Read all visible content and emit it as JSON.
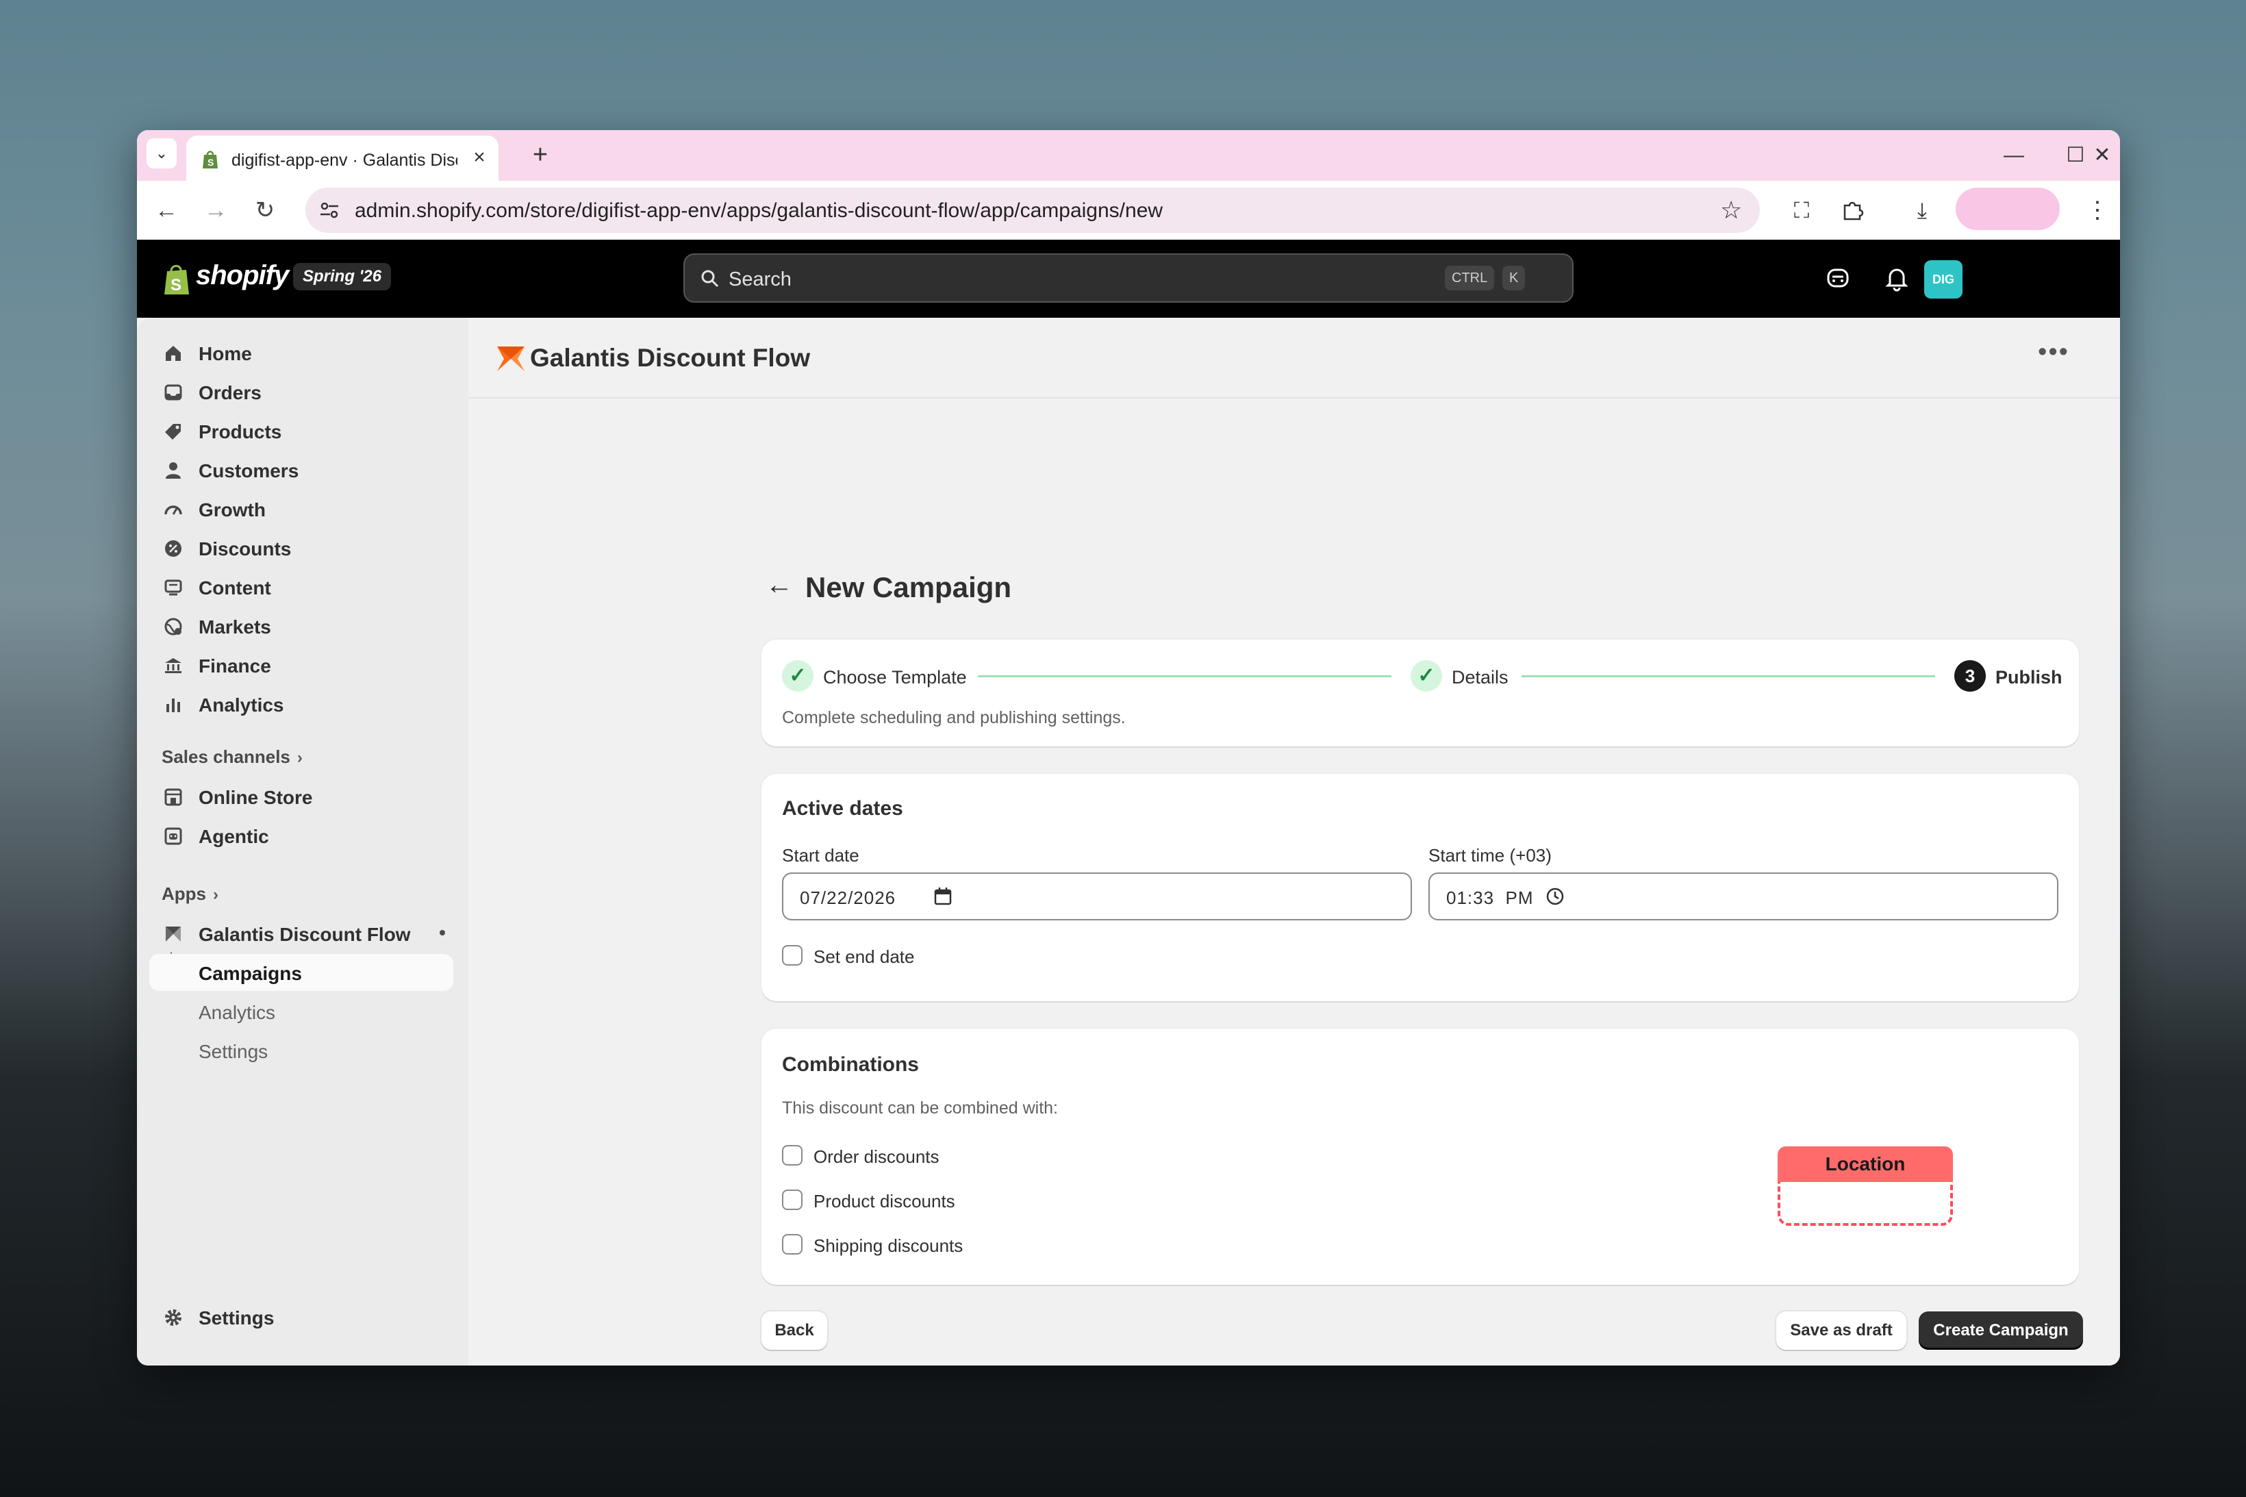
{
  "browser": {
    "tab_title": "digifist-app-env · Galantis Disco",
    "url": "admin.shopify.com/store/digifist-app-env/apps/galantis-discount-flow/app/campaigns/new"
  },
  "shopify": {
    "wordmark": "shopify",
    "edition_badge": "Spring '26",
    "search_placeholder": "Search",
    "shortcut_keys": [
      "CTRL",
      "K"
    ],
    "avatar_initials": "DIG",
    "avatar_color": "#2ec4c6"
  },
  "sidebar": {
    "items": [
      {
        "label": "Home",
        "icon": "home-icon"
      },
      {
        "label": "Orders",
        "icon": "inbox-icon"
      },
      {
        "label": "Products",
        "icon": "tag-icon"
      },
      {
        "label": "Customers",
        "icon": "person-icon"
      },
      {
        "label": "Growth",
        "icon": "gauge-icon"
      },
      {
        "label": "Discounts",
        "icon": "discount-icon"
      },
      {
        "label": "Content",
        "icon": "content-icon"
      },
      {
        "label": "Markets",
        "icon": "globe-icon"
      },
      {
        "label": "Finance",
        "icon": "bank-icon"
      },
      {
        "label": "Analytics",
        "icon": "bar-chart-icon"
      }
    ],
    "sales_channels_label": "Sales channels",
    "channels": [
      {
        "label": "Online Store",
        "icon": "store-icon"
      },
      {
        "label": "Agentic",
        "icon": "agentic-icon"
      }
    ],
    "apps_label": "Apps",
    "app_name": "Galantis Discount Flow",
    "app_subitems": [
      "Campaigns",
      "Analytics",
      "Settings"
    ],
    "active_subitem": "Campaigns",
    "settings_label": "Settings"
  },
  "app": {
    "title": "Galantis Discount Flow",
    "brand_color": "#ff6a13"
  },
  "page": {
    "title": "New Campaign",
    "steps": [
      {
        "label": "Choose Template",
        "state": "complete"
      },
      {
        "label": "Details",
        "state": "complete"
      },
      {
        "label": "Publish",
        "state": "current",
        "number": "3"
      }
    ],
    "step_hint": "Complete scheduling and publishing settings.",
    "active_dates": {
      "header": "Active dates",
      "start_date_label": "Start date",
      "start_date_value": "07/22/2026",
      "start_time_label": "Start time (+03)",
      "start_time_value": "01:33  PM",
      "set_end_date_label": "Set end date"
    },
    "combinations": {
      "header": "Combinations",
      "subtitle": "This discount can be combined with:",
      "options": [
        "Order discounts",
        "Product discounts",
        "Shipping discounts"
      ]
    },
    "buttons": {
      "back": "Back",
      "save_draft": "Save as draft",
      "create": "Create Campaign"
    },
    "annotation_label": "Location",
    "annotation_color": "#ff6b6b"
  }
}
